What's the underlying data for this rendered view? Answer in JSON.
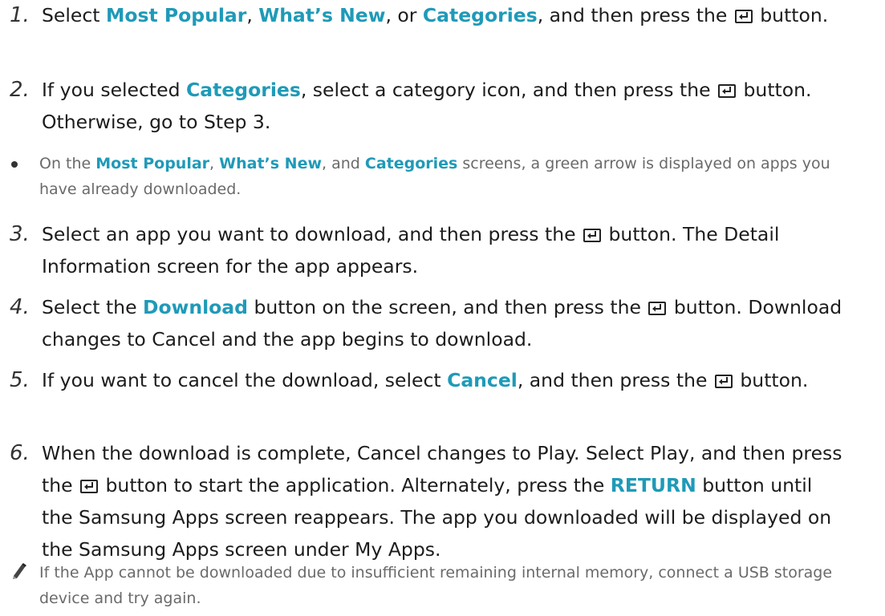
{
  "steps": [
    {
      "number": "1.",
      "parts": [
        {
          "text": "Select "
        },
        {
          "text": "Most Popular",
          "hl": true
        },
        {
          "text": ", "
        },
        {
          "text": "What’s New",
          "hl": true
        },
        {
          "text": ", or "
        },
        {
          "text": "Categories",
          "hl": true
        },
        {
          "text": ", and then press the "
        },
        {
          "icon": "enter-button-icon"
        },
        {
          "text": " button."
        }
      ]
    },
    {
      "number": "2.",
      "parts": [
        {
          "text": "If you selected "
        },
        {
          "text": "Categories",
          "hl": true
        },
        {
          "text": ", select a category icon, and then press the "
        },
        {
          "icon": "enter-button-icon"
        },
        {
          "text": " button. Otherwise, go to Step 3."
        }
      ]
    },
    {
      "number": "3.",
      "parts": [
        {
          "text": "Select an app you want to download, and then press the "
        },
        {
          "icon": "enter-button-icon"
        },
        {
          "text": " button. The Detail Information screen for the app appears."
        }
      ]
    },
    {
      "number": "4.",
      "parts": [
        {
          "text": "Select the "
        },
        {
          "text": "Download",
          "hl": true
        },
        {
          "text": " button on the screen, and then press the "
        },
        {
          "icon": "enter-button-icon"
        },
        {
          "text": " button. Download changes to Cancel and the app begins to download."
        }
      ]
    },
    {
      "number": "5.",
      "parts": [
        {
          "text": "If you want to cancel the download, select "
        },
        {
          "text": "Cancel",
          "hl": true
        },
        {
          "text": ", and then press the "
        },
        {
          "icon": "enter-button-icon"
        },
        {
          "text": " button."
        }
      ]
    },
    {
      "number": "6.",
      "parts": [
        {
          "text": "When the download is complete, Cancel changes to Play. Select Play, and then press the "
        },
        {
          "icon": "enter-button-icon"
        },
        {
          "text": " button to start the application. Alternately, press the "
        },
        {
          "text": "RETURN",
          "hl": true
        },
        {
          "text": " button until the Samsung Apps screen reappears. The app you downloaded will be displayed on the Samsung Apps screen under My Apps."
        }
      ]
    }
  ],
  "bullet_note": {
    "icon": "bullet-icon",
    "parts": [
      {
        "text": "On the "
      },
      {
        "text": "Most Popular",
        "hl": true
      },
      {
        "text": ", "
      },
      {
        "text": "What’s New",
        "hl": true
      },
      {
        "text": ", and "
      },
      {
        "text": "Categories",
        "hl": true
      },
      {
        "text": " screens, a green arrow is displayed on apps you have already downloaded."
      }
    ]
  },
  "pencil_note": {
    "icon": "pencil-icon",
    "parts": [
      {
        "text": "If the App cannot be downloaded due to insufficient remaining internal memory, connect a USB storage device and try again."
      }
    ]
  },
  "colors": {
    "highlight": "#1f9ab8",
    "body_text": "#1c1c1c",
    "note_text": "#6a6a6a"
  }
}
